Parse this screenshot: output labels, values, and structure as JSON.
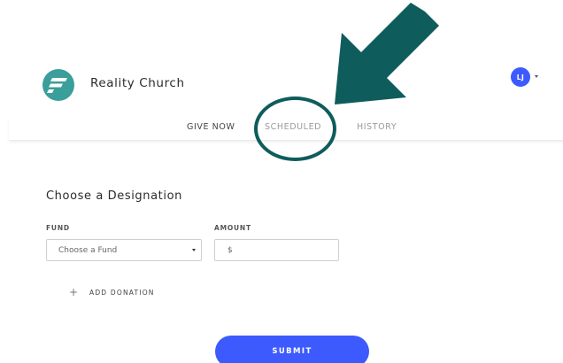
{
  "brand": {
    "name": "Reality Church",
    "logo_icon": "reality-church-logo",
    "logo_color": "#3a9e9a"
  },
  "user": {
    "initials": "LJ",
    "avatar_color": "#3d5afe"
  },
  "tabs": [
    {
      "label": "GIVE NOW",
      "active": true
    },
    {
      "label": "SCHEDULED",
      "active": false
    },
    {
      "label": "HISTORY",
      "active": false
    }
  ],
  "form": {
    "title": "Choose a Designation",
    "fund_label": "FUND",
    "fund_value": "Choose a Fund",
    "amount_label": "AMOUNT",
    "amount_prefix": "$",
    "add_donation_label": "ADD DONATION",
    "submit_label": "SUBMIT"
  },
  "colors": {
    "accent": "#3d5afe",
    "annotation": "#0f5c5c"
  }
}
